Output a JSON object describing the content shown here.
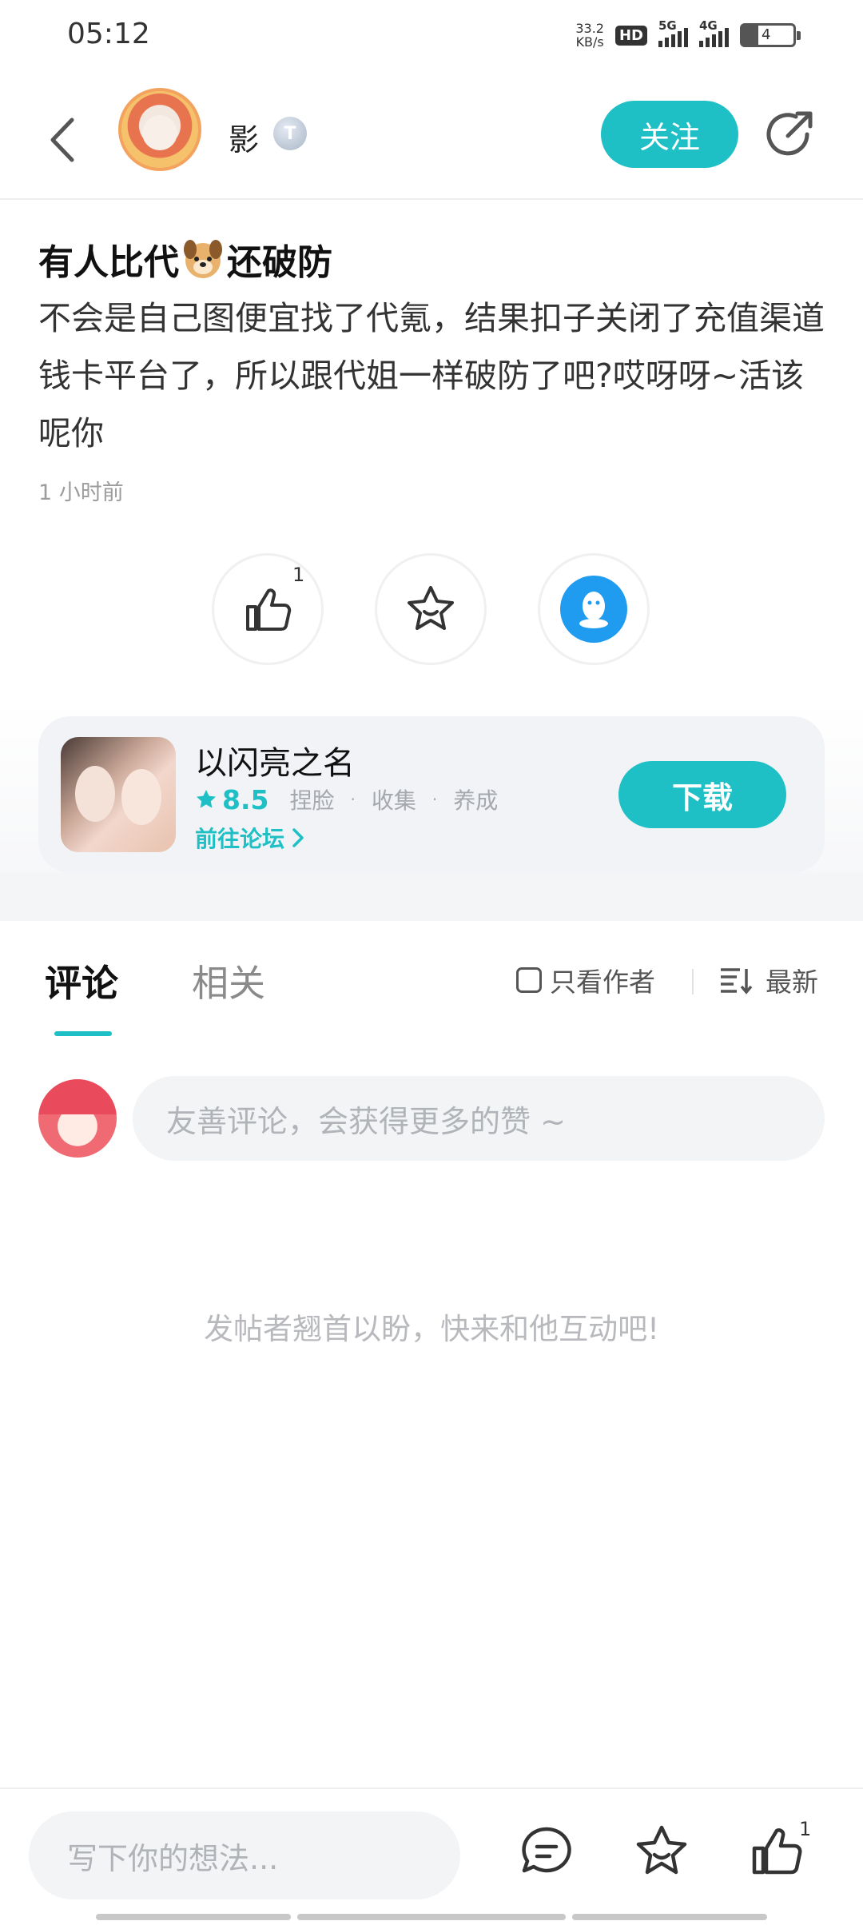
{
  "status_bar": {
    "time": "05:12",
    "net_speed_value": "33.2",
    "net_speed_unit": "KB/s",
    "hd_label": "HD",
    "sim1_label": "5G",
    "sim2_label": "4G",
    "battery_level": "4"
  },
  "header": {
    "author_name": "影",
    "level_badge": "T",
    "follow_label": "关注"
  },
  "post": {
    "title_before": "有人比代",
    "title_after": "还破防",
    "body": "不会是自己图便宜找了代氪，结果扣子关闭了充值渠道钱卡平台了，所以跟代姐一样破防了吧?哎呀呀~活该呢你",
    "time": "1 小时前"
  },
  "actions": {
    "like_count": "1"
  },
  "app_card": {
    "name": "以闪亮之名",
    "rating": "8.5",
    "tags": [
      "捏脸",
      "收集",
      "养成"
    ],
    "forum_link": "前往论坛",
    "download_label": "下载"
  },
  "tabs": {
    "comments": "评论",
    "related": "相关",
    "author_only": "只看作者",
    "sort": "最新"
  },
  "comment": {
    "placeholder": "友善评论，会获得更多的赞 ~",
    "empty": "发帖者翘首以盼，快来和他互动吧!"
  },
  "bottom_bar": {
    "placeholder": "写下你的想法...",
    "like_count": "1"
  },
  "colors": {
    "accent": "#1ec0c6",
    "qq_blue": "#1f9cf0"
  },
  "icons": [
    "back-icon",
    "share-icon",
    "dog-icon",
    "like-icon",
    "collect-icon",
    "qq-icon",
    "star-icon",
    "chevron-right-icon",
    "sort-icon",
    "comment-icon"
  ]
}
